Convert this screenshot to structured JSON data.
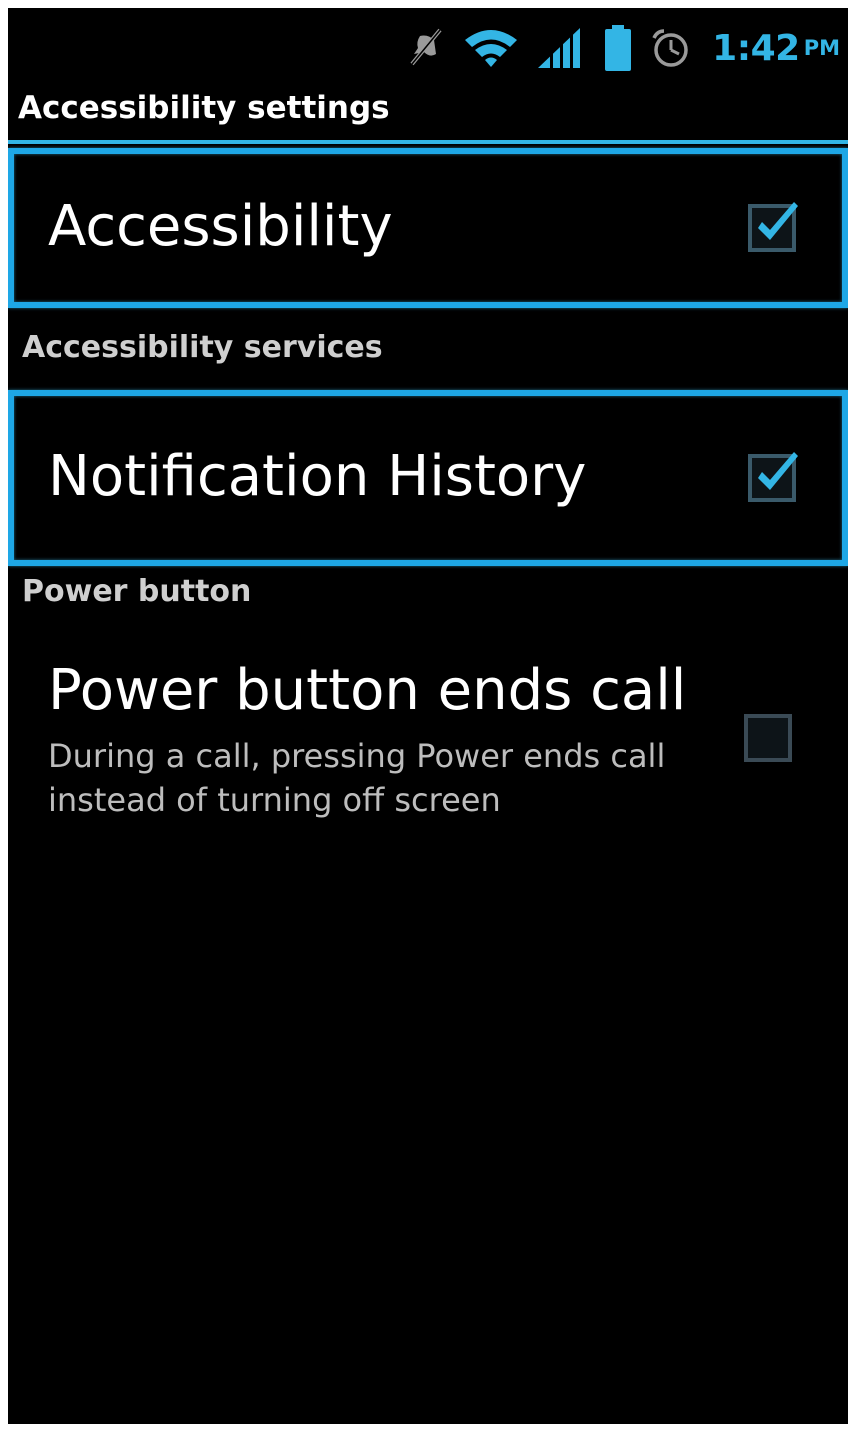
{
  "status_bar": {
    "icons": [
      "mute-icon",
      "wifi-icon",
      "signal-icon",
      "battery-icon",
      "alarm-icon"
    ],
    "time": "1:42",
    "ampm": "PM"
  },
  "title": "Accessibility settings",
  "accessibility": {
    "label": "Accessibility",
    "checked": true
  },
  "services_header": "Accessibility services",
  "notification_history": {
    "label": "Notification History",
    "checked": true
  },
  "power_header": "Power button",
  "power_ends_call": {
    "label": "Power button ends call",
    "summary": "During a call, pressing Power ends call instead of turning off screen",
    "checked": false
  },
  "colors": {
    "accent": "#33b5e5",
    "background": "#000000",
    "text": "#ffffff",
    "secondary_text": "#bdbdbd"
  }
}
